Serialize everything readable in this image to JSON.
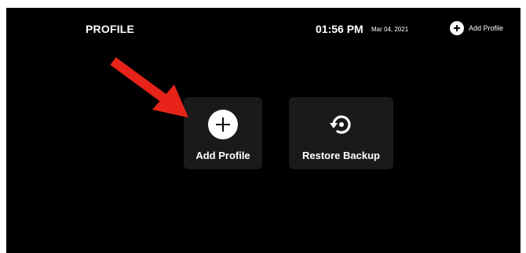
{
  "header": {
    "title": "PROFILE",
    "time": "01:56 PM",
    "date": "Mar 04, 2021",
    "add_profile_label": "Add Profile"
  },
  "tiles": [
    {
      "label": "Add Profile",
      "icon": "plus-circle-icon"
    },
    {
      "label": "Restore Backup",
      "icon": "restore-icon"
    }
  ],
  "annotation": {
    "icon": "red-arrow-icon",
    "color": "#e8231a"
  },
  "colors": {
    "background": "#000000",
    "tile": "#1a1a1a",
    "text": "#ffffff"
  }
}
